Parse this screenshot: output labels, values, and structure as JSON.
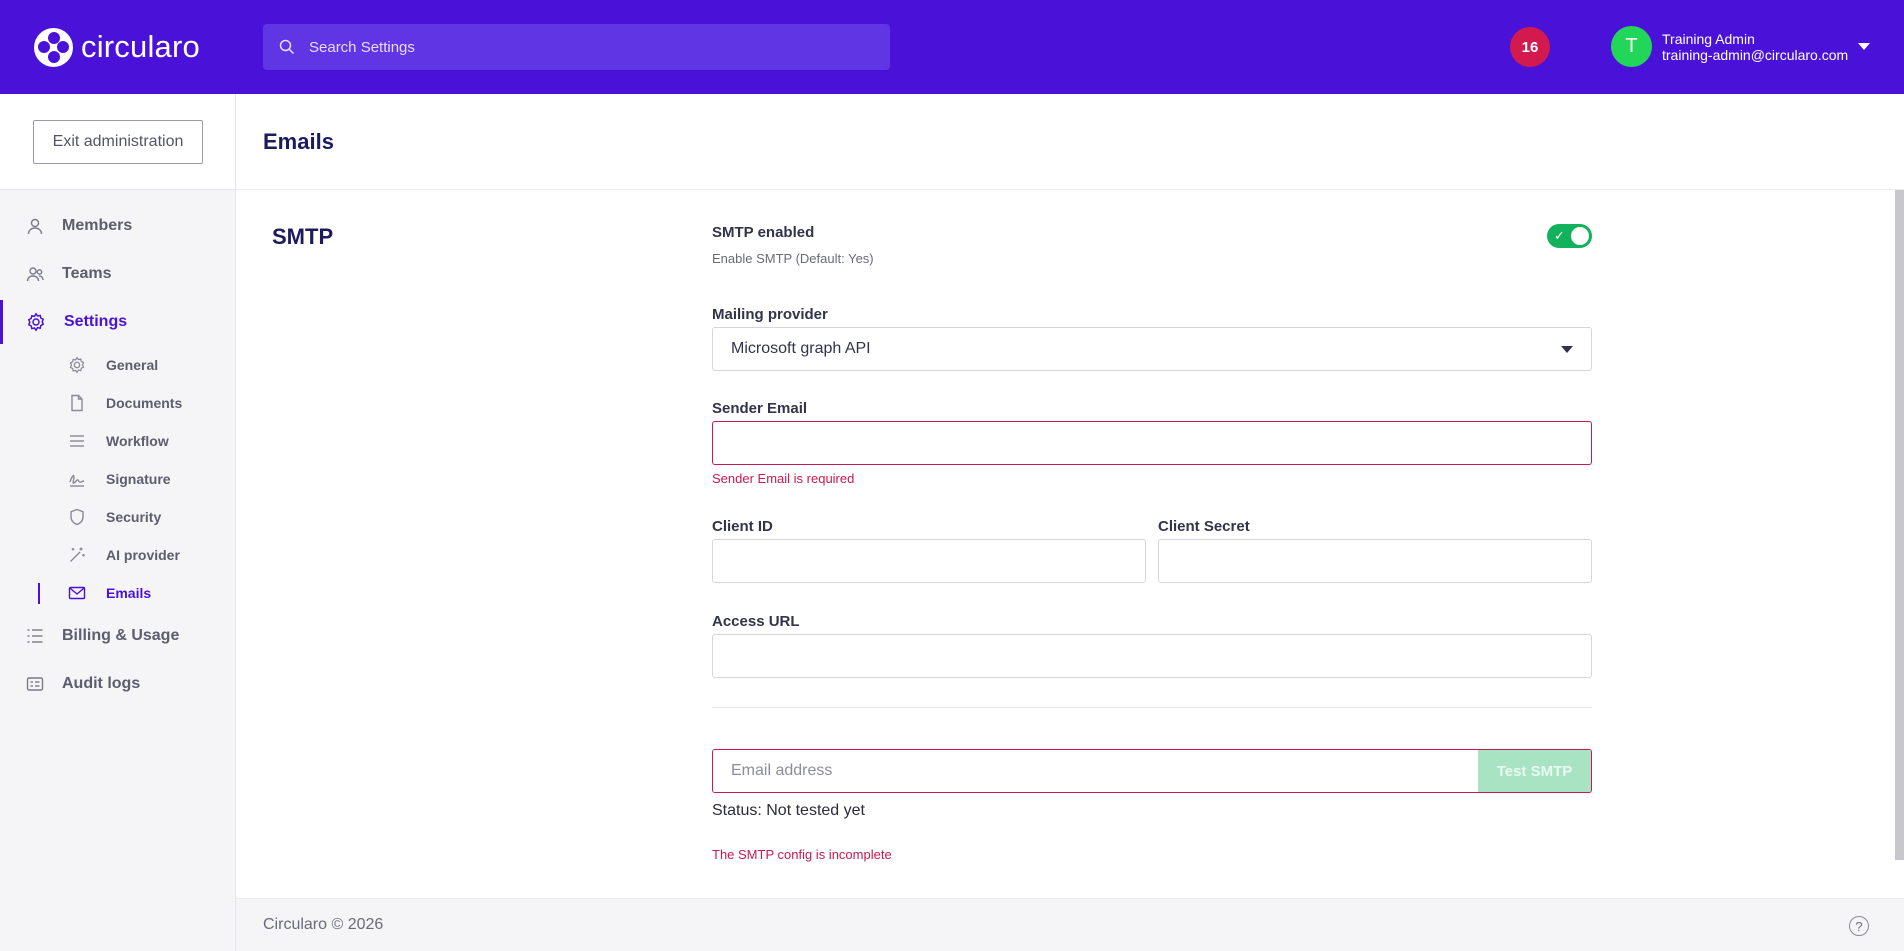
{
  "header": {
    "logo_text": "circularo",
    "search_placeholder": "Search Settings",
    "notification_count": "16",
    "user": {
      "avatar_letter": "T",
      "name": "Training Admin",
      "email": "training-admin@circularo.com"
    },
    "brand_color": "#4a12d8"
  },
  "sidebar": {
    "exit_label": "Exit administration",
    "items": [
      {
        "label": "Members",
        "icon": "person-icon"
      },
      {
        "label": "Teams",
        "icon": "people-icon"
      },
      {
        "label": "Settings",
        "icon": "gear-icon",
        "active": true
      },
      {
        "label": "Billing & Usage",
        "icon": "list-icon"
      },
      {
        "label": "Audit logs",
        "icon": "log-icon"
      }
    ],
    "sub_items": [
      {
        "label": "General",
        "icon": "gear-icon"
      },
      {
        "label": "Documents",
        "icon": "document-icon"
      },
      {
        "label": "Workflow",
        "icon": "workflow-icon"
      },
      {
        "label": "Signature",
        "icon": "signature-icon"
      },
      {
        "label": "Security",
        "icon": "shield-icon"
      },
      {
        "label": "AI provider",
        "icon": "magic-wand-icon"
      },
      {
        "label": "Emails",
        "icon": "envelope-icon",
        "active": true
      }
    ]
  },
  "page": {
    "title": "Emails",
    "section_title": "SMTP"
  },
  "form": {
    "smtp_enabled_label": "SMTP enabled",
    "smtp_enabled_hint": "Enable SMTP  (Default: Yes)",
    "smtp_enabled": true,
    "mailing_provider_label": "Mailing provider",
    "mailing_provider_value": "Microsoft graph API",
    "sender_email_label": "Sender Email",
    "sender_email_value": "",
    "sender_email_error": "Sender Email is required",
    "client_id_label": "Client ID",
    "client_id_value": "",
    "client_secret_label": "Client Secret",
    "client_secret_value": "",
    "access_url_label": "Access URL",
    "access_url_value": "",
    "test_email_placeholder": "Email address",
    "test_button_label": "Test SMTP",
    "status_text": "Status: Not tested yet",
    "config_error": "The SMTP config is incomplete"
  },
  "footer": {
    "copyright": "Circularo © 2026",
    "help_icon": "?"
  }
}
